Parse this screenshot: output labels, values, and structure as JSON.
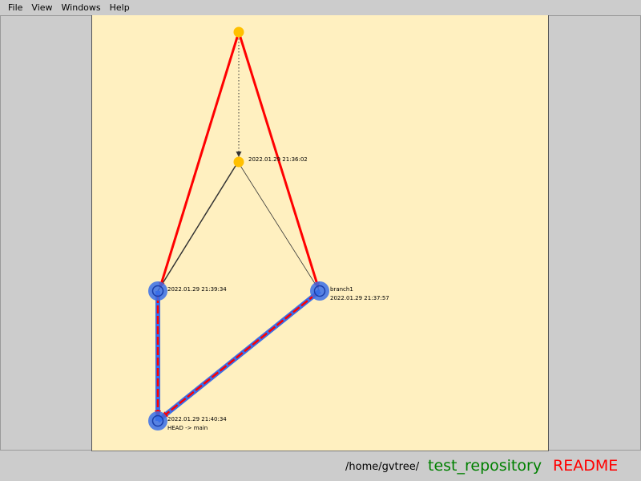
{
  "menu": {
    "items": [
      "File",
      "View",
      "Windows",
      "Help"
    ]
  },
  "graph": {
    "commits": {
      "commit_2136": {
        "date": "2022.01.29 21:36:02"
      },
      "commit_2139": {
        "date": "2022.01.29 21:39:34"
      },
      "commit_2137": {
        "branch": "branch1",
        "date": "2022.01.29 21:37:57"
      },
      "commit_2140": {
        "date": "2022.01.29 21:40:34",
        "ref": "HEAD -> main"
      }
    },
    "colors": {
      "background": "#fff0c0",
      "root_node": "#ffc000",
      "branch_node": "#3a6ee8",
      "highlight_edge": "#ff0000",
      "parent_edge": "#333333"
    }
  },
  "status": {
    "path": "/home/gvtree/",
    "repository": "test_repository",
    "file": "README"
  }
}
